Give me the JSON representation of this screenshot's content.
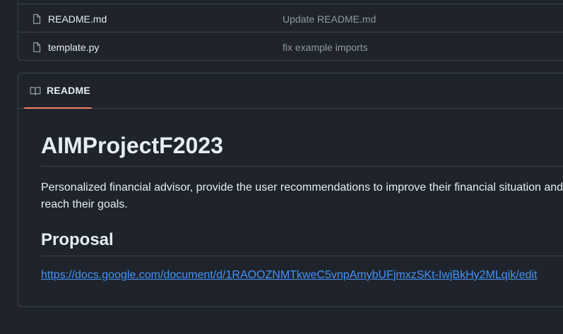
{
  "files": [
    {
      "icon": "file-icon",
      "name": "README.md",
      "commit": "Update README.md"
    },
    {
      "icon": "file-icon",
      "name": "template.py",
      "commit": "fix example imports"
    }
  ],
  "readme": {
    "tab_icon": "book-icon",
    "tab_label": "README",
    "title": "AIMProjectF2023",
    "description": "Personalized financial advisor, provide the user recommendations to improve their financial situation and reach their goals.",
    "section_heading": "Proposal",
    "link_text": "https://docs.google.com/document/d/1RAOOZNMTkweC5vnpAmybUFjmxzSKt-IwjBkHy2MLqik/edit"
  },
  "colors": {
    "background": "#1f242c",
    "border": "#3d444d",
    "text": "#e6edf3",
    "muted": "#9198a1",
    "link": "#4493f8",
    "tab_accent": "#f78166"
  }
}
